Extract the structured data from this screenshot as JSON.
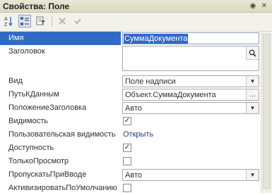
{
  "window": {
    "title": "Свойства: Поле"
  },
  "toolbar": {
    "buttons": [
      {
        "name": "sort-alpha-icon",
        "label": "AZ"
      },
      {
        "name": "categories-icon"
      },
      {
        "name": "filter-icon"
      },
      {
        "name": "close-icon"
      },
      {
        "name": "check-icon"
      }
    ]
  },
  "properties": {
    "name": {
      "label": "Имя",
      "value": "СуммаДокумента"
    },
    "header": {
      "label": "Заголовок",
      "value": ""
    },
    "view": {
      "label": "Вид",
      "value": "Поле надписи"
    },
    "datapath": {
      "label": "ПутьКДанным",
      "value": "Объект.СуммаДокумента"
    },
    "header_position": {
      "label": "ПоложениеЗаголовка",
      "value": "Авто"
    },
    "visibility": {
      "label": "Видимость",
      "checked": true
    },
    "user_visibility": {
      "label": "Пользовательская видимость",
      "link": "Открыть"
    },
    "enabled": {
      "label": "Доступность",
      "checked": true
    },
    "readonly": {
      "label": "ТолькоПросмотр",
      "checked": false
    },
    "skip_on_input": {
      "label": "ПропускатьПриВводе",
      "value": "Авто"
    },
    "activate_default": {
      "label": "АктивизироватьПоУмолчанию",
      "checked": false
    }
  },
  "colors": {
    "selection": "#3169c6",
    "link": "#243a8c"
  }
}
